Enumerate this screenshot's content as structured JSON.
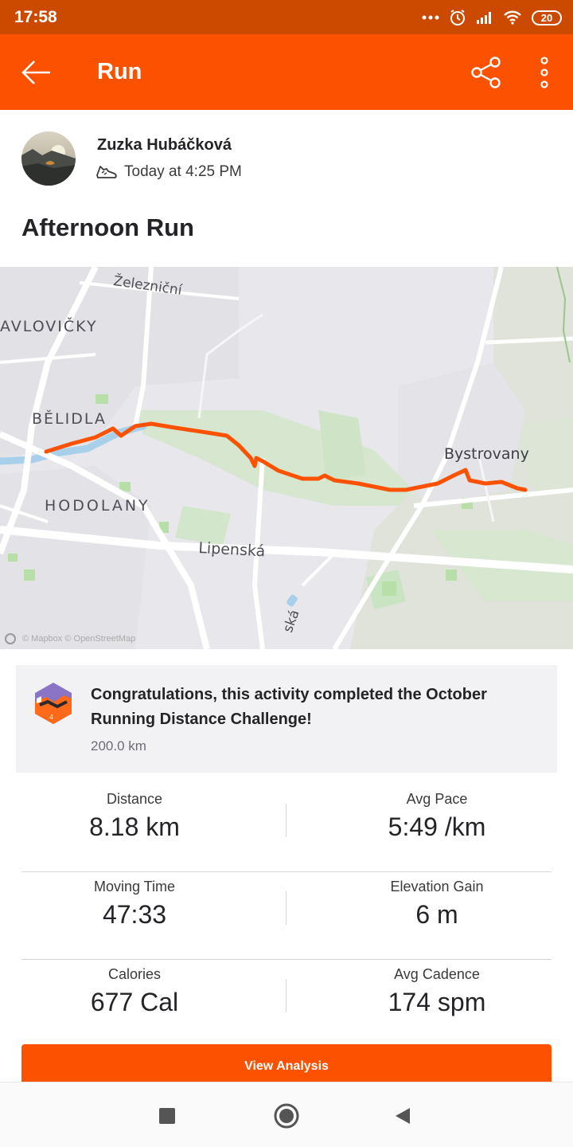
{
  "status_bar": {
    "time": "17:58",
    "battery": "20"
  },
  "app_bar": {
    "title": "Run"
  },
  "activity": {
    "athlete_name": "Zuzka Hubáčková",
    "date": "Today at 4:25 PM",
    "title": "Afternoon Run"
  },
  "map": {
    "labels": {
      "zeleznicni": "Železniční",
      "pavlovicky": "AVLOVIČKY",
      "belidla": "BĚLIDLA",
      "hodolany": "HODOLANY",
      "bystrovany": "Bystrovany",
      "lipenska": "Lipenská",
      "ska": "ská"
    },
    "attribution": "© Mapbox © OpenStreetMap",
    "route_color": "#fc5200"
  },
  "challenge": {
    "text": "Congratulations, this activity completed the October Running Distance Challenge!",
    "distance": "200.0 km"
  },
  "stats": {
    "distance": {
      "label": "Distance",
      "value": "8.18 km"
    },
    "avg_pace": {
      "label": "Avg Pace",
      "value": "5:49 /km"
    },
    "moving_time": {
      "label": "Moving Time",
      "value": "47:33"
    },
    "elevation_gain": {
      "label": "Elevation Gain",
      "value": "6 m"
    },
    "calories": {
      "label": "Calories",
      "value": "677 Cal"
    },
    "avg_cadence": {
      "label": "Avg Cadence",
      "value": "174 spm"
    }
  },
  "buttons": {
    "view_analysis": "View Analysis"
  },
  "colors": {
    "brand": "#fc5200",
    "status_bar": "#cc4a00"
  }
}
